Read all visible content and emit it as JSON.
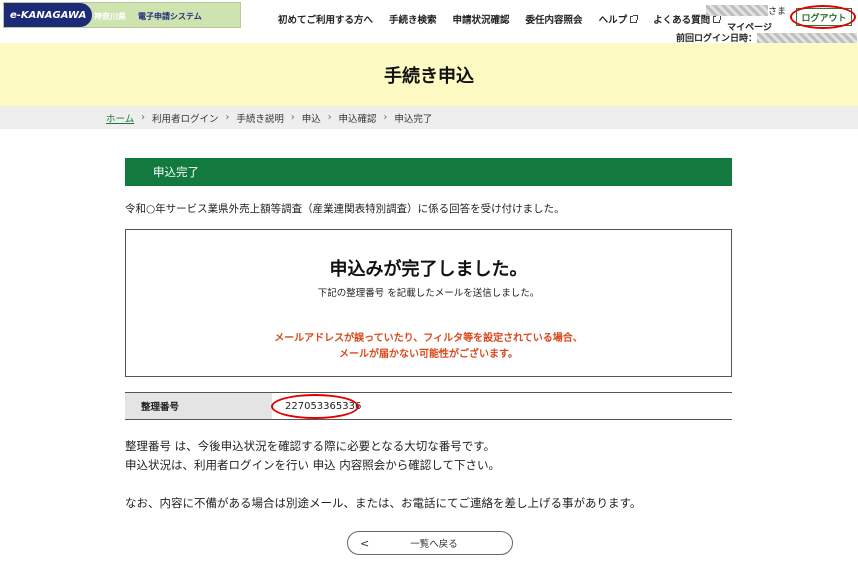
{
  "header": {
    "logo_brand": "e-KANAGAWA",
    "logo_pref": "神奈川県",
    "logo_system": "電子申請システム",
    "nav": [
      {
        "label": "初めてご利用する方へ",
        "external": false
      },
      {
        "label": "手続き検索",
        "external": false
      },
      {
        "label": "申請状況確認",
        "external": false
      },
      {
        "label": "委任内容照会",
        "external": false
      },
      {
        "label": "ヘルプ",
        "external": true
      },
      {
        "label": "よくある質問",
        "external": true
      }
    ],
    "user_suffix": "さま",
    "mypage_label": "マイページ",
    "last_login_label": "前回ログイン日時：",
    "logout_label": "ログアウト"
  },
  "page": {
    "title": "手続き申込"
  },
  "breadcrumb": [
    "ホーム",
    "利用者ログイン",
    "手続き説明",
    "申込",
    "申込確認",
    "申込完了"
  ],
  "section": {
    "heading": "申込完了",
    "received_text": "令和○年サービス業県外売上額等調査（産業連関表特別調査）に係る回答を受け付けました。"
  },
  "completion": {
    "message": "申込みが完了しました。",
    "mail_sent": "下記の整理番号 を記載したメールを送信しました。",
    "warning_line1": "メールアドレスが誤っていたり、フィルタ等を設定されている場合、",
    "warning_line2": "メールが届かない可能性がございます。"
  },
  "reference": {
    "label": "整理番号",
    "value": "227053365336"
  },
  "notes": {
    "line1": "整理番号 は、今後申込状況を確認する際に必要となる大切な番号です。",
    "line2": "申込状況は、利用者ログインを行い 申込 内容照会から確認して下さい。",
    "line3": "なお、内容に不備がある場合は別途メール、または、お電話にてご連絡を差し上げる事があります。"
  },
  "back_button": {
    "chevron": "<",
    "label": "一覧へ戻る"
  },
  "colors": {
    "section_green": "#137a3f",
    "title_band": "#fdfbc3",
    "warning_orange": "#d9481a",
    "annotation_red": "#e00000"
  }
}
